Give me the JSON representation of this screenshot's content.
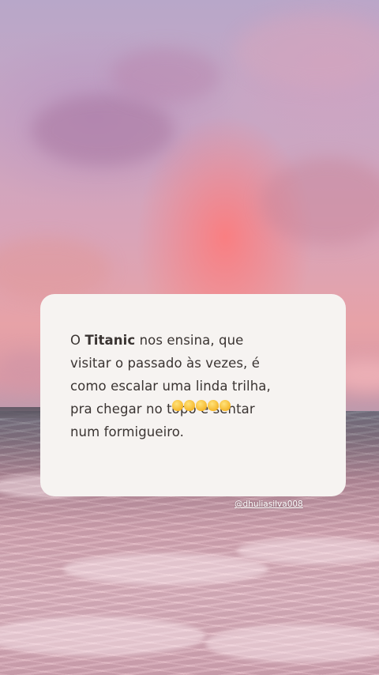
{
  "quote": {
    "prefix": "O ",
    "highlight": "Titanic",
    "line1_rest": " nos ensina, que",
    "line2": "visitar o passado às vezes, é",
    "line3": "como escalar uma linda trilha,",
    "line4": "pra chegar no topo e sentar",
    "line5": "num formigueiro."
  },
  "emoji": {
    "icon": "clapping-hands-icon",
    "count": 5
  },
  "watermark": {
    "handle": "@dhuliasilva008"
  },
  "colors": {
    "card_background": "#f6f3f1",
    "text": "#3a3432",
    "sky_glow": "#e7a2a7"
  }
}
